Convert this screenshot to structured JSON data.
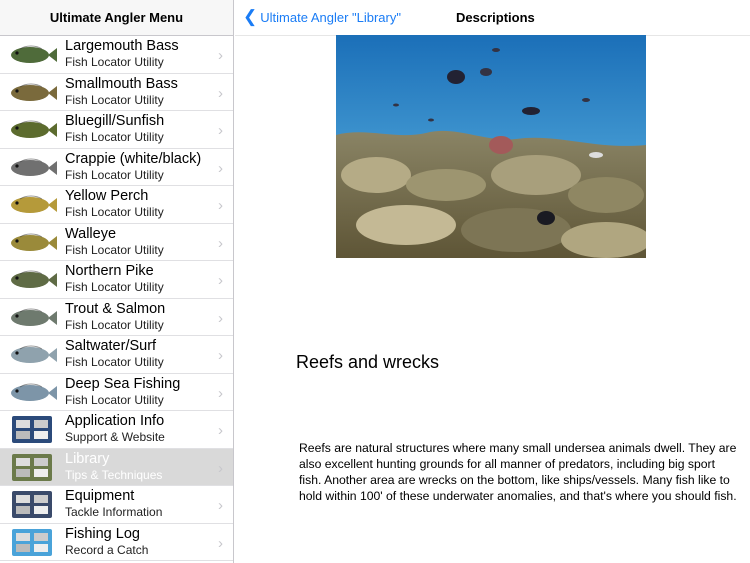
{
  "sidebar": {
    "title": "Ultimate Angler Menu",
    "items": [
      {
        "title": "Largemouth Bass",
        "subtitle": "Fish Locator Utility",
        "icon": "largemouth-bass-icon",
        "color": "#4f6b3a"
      },
      {
        "title": "Smallmouth Bass",
        "subtitle": "Fish Locator Utility",
        "icon": "smallmouth-bass-icon",
        "color": "#7a6a3c"
      },
      {
        "title": "Bluegill/Sunfish",
        "subtitle": "Fish Locator Utility",
        "icon": "bluegill-icon",
        "color": "#5c6b2e"
      },
      {
        "title": "Crappie (white/black)",
        "subtitle": "Fish Locator Utility",
        "icon": "crappie-icon",
        "color": "#707070"
      },
      {
        "title": "Yellow Perch",
        "subtitle": "Fish Locator Utility",
        "icon": "yellow-perch-icon",
        "color": "#b59a3a"
      },
      {
        "title": "Walleye",
        "subtitle": "Fish Locator Utility",
        "icon": "walleye-icon",
        "color": "#9a8a3a"
      },
      {
        "title": "Northern Pike",
        "subtitle": "Fish Locator Utility",
        "icon": "northern-pike-icon",
        "color": "#5f6b45"
      },
      {
        "title": "Trout & Salmon",
        "subtitle": "Fish Locator Utility",
        "icon": "trout-icon",
        "color": "#6e7a6e"
      },
      {
        "title": "Saltwater/Surf",
        "subtitle": "Fish Locator Utility",
        "icon": "saltwater-fish-icon",
        "color": "#8fa2ad"
      },
      {
        "title": "Deep Sea Fishing",
        "subtitle": "Fish Locator Utility",
        "icon": "deep-sea-fish-icon",
        "color": "#7d95a8"
      },
      {
        "title": "Application Info",
        "subtitle": "Support & Website",
        "icon": "app-info-icon",
        "color": "#2b4a7a"
      },
      {
        "title": "Library",
        "subtitle": "Tips & Techniques",
        "icon": "library-icon",
        "color": "#6b7a4a",
        "selected": true
      },
      {
        "title": "Equipment",
        "subtitle": "Tackle Information",
        "icon": "tackle-box-icon",
        "color": "#3a4a6a"
      },
      {
        "title": "Fishing Log",
        "subtitle": "Record a Catch",
        "icon": "fishing-log-icon",
        "color": "#4aa3d9"
      }
    ]
  },
  "header": {
    "back_label": "Ultimate Angler \"Library\"",
    "title": "Descriptions"
  },
  "article": {
    "image": "underwater-reef-photo",
    "heading": "Reefs and wrecks",
    "body": "Reefs are natural structures where many small undersea animals dwell. They are also excellent hunting grounds for all manner of predators, including big sport fish. Another area are wrecks on the bottom, like ships/vessels. Many fish like to hold within 100' of these underwater anomalies, and that's where you should fish."
  },
  "colors": {
    "accent": "#1a7cf5",
    "chevron": "#c7c7cc",
    "selected_row": "#d9d9d9"
  }
}
